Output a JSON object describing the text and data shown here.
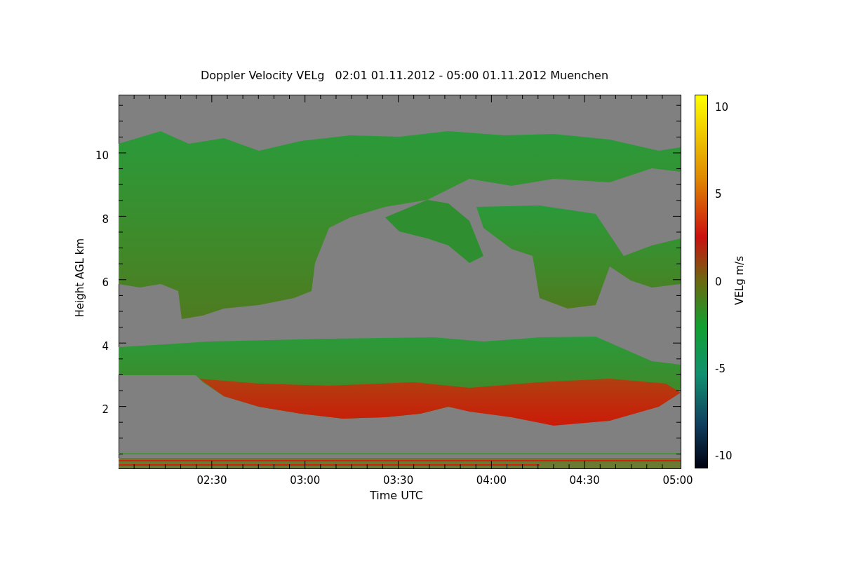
{
  "title": "Doppler Velocity VELg   02:01 01.11.2012 - 05:00 01.11.2012 Muenchen",
  "y_axis": {
    "label": "Height AGL km",
    "ticks": [
      "10",
      "8",
      "6",
      "4",
      "2"
    ]
  },
  "x_axis": {
    "label": "Time UTC",
    "ticks": [
      "02:30",
      "03:00",
      "03:30",
      "04:00",
      "04:30",
      "05:00"
    ]
  },
  "colorbar": {
    "label": "VELg m/s",
    "ticks": [
      "10",
      "5",
      "0",
      "-5",
      "-10"
    ]
  }
}
